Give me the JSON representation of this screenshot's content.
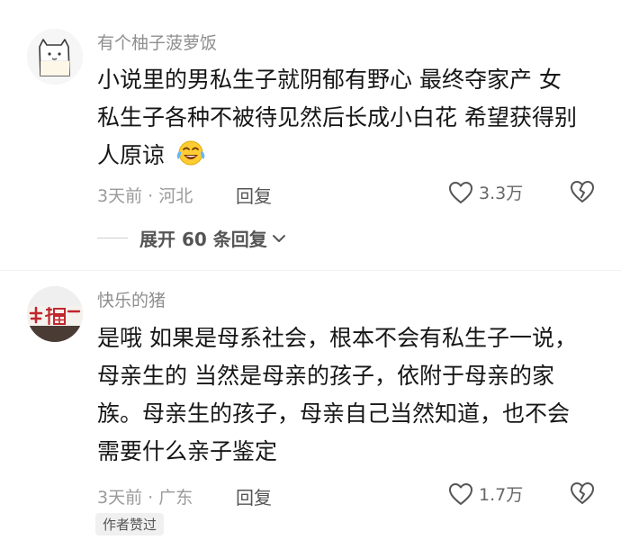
{
  "comments": [
    {
      "username": "有个柚子菠萝饭",
      "avatar_icon": "cat-cup-icon",
      "content_lines": [
        "小说里的男私生子就阴郁有野心 最终夺家产 女",
        "私生子各种不被待见然后长成小白花 希望获得别",
        "人原谅"
      ],
      "emoji_icon": "laughing-crying-emoji-icon",
      "time": "3天前",
      "location": "河北",
      "reply_label": "回复",
      "like_count": "3.3万",
      "expand_label": "展开 60 条回复"
    },
    {
      "username": "快乐的猪",
      "avatar_icon": "fu-character-banner-icon",
      "content_lines": [
        "是哦 如果是母系社会，根本不会有私生子一说，",
        "母亲生的 当然是母亲的孩子，依附于母亲的家",
        "族。母亲生的孩子，母亲自己当然知道，也不会",
        "需要什么亲子鉴定"
      ],
      "time": "3天前",
      "location": "广东",
      "reply_label": "回复",
      "like_count": "1.7万",
      "author_badge": "作者赞过"
    }
  ],
  "colors": {
    "text": "#161616",
    "secondary": "#8f8f8f",
    "action": "#555555"
  }
}
